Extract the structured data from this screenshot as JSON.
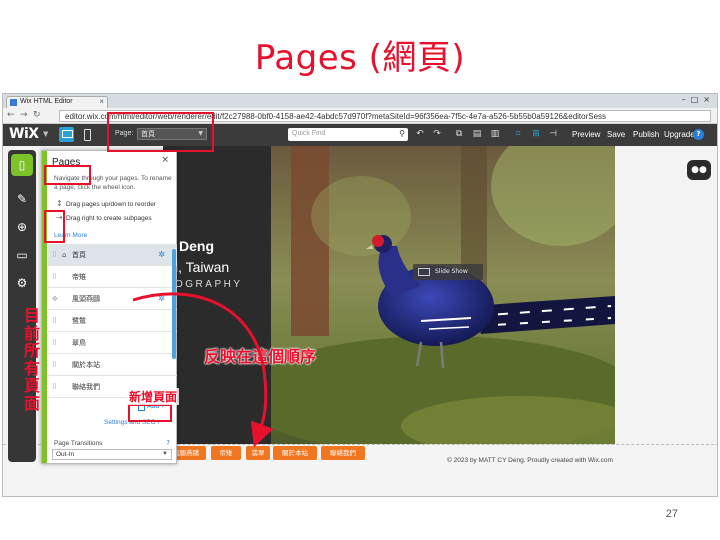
{
  "slide": {
    "title": "Pages (網頁)",
    "page_number": "27"
  },
  "browser": {
    "tab_title": "Wix HTML Editor",
    "url": "editor.wix.com/html/editor/web/renderer/edit/f2c27988-0bf0-4158-ae42-4abdc57d970f?metaSiteId=96f356ea-7f5c-4e7a-a526-5b55b0a59126&editorSess"
  },
  "wix_topbar": {
    "logo": "WiX",
    "page_label": "Page:",
    "page_select_value": "首頁",
    "search_placeholder": "Quick Find",
    "buttons": {
      "preview": "Preview",
      "save": "Save",
      "publish": "Publish",
      "upgrade": "Upgrade"
    },
    "help": "?"
  },
  "site": {
    "name": "Deng",
    "location": "i, Taiwan",
    "photography": "OGRAPHY",
    "slideshow_label": "Slide Show",
    "footer_buttons": [
      "風頭燕鷗",
      "帝雉",
      "翡翠",
      "巫鳥",
      "關於本站",
      "聯絡我們"
    ],
    "copyright": "© 2023 by MATT CY Deng. Proudly created with Wix.com"
  },
  "pages_panel": {
    "title": "Pages",
    "description": "Navigate through your pages. To rename a page, click the wheel icon.",
    "hint_reorder": "Drag pages up/down to reorder",
    "hint_subpages": "Drag right to create subpages",
    "learn_more": "Learn More",
    "pages": [
      {
        "name": "首頁",
        "home": true,
        "selected": true
      },
      {
        "name": "帝雉"
      },
      {
        "name": "風頭燕鷗"
      },
      {
        "name": "鷺鷥"
      },
      {
        "name": "翠鳥"
      },
      {
        "name": "關於本站"
      },
      {
        "name": "聯絡我們"
      }
    ],
    "add_label": "Add",
    "settings_link": "Settings and SEO",
    "transitions_label": "Page Transitions",
    "transitions_value": "Out-In",
    "transitions_help": "?"
  },
  "annotations": {
    "current_pages": "目前所有頁面",
    "reorder_note": "反映在這個順序",
    "add_page": "新增頁面"
  },
  "colors": {
    "accent_red": "#e8112d",
    "wix_green": "#7dc229",
    "wix_blue": "#2aa1d6",
    "footer_orange": "#f0771f"
  }
}
